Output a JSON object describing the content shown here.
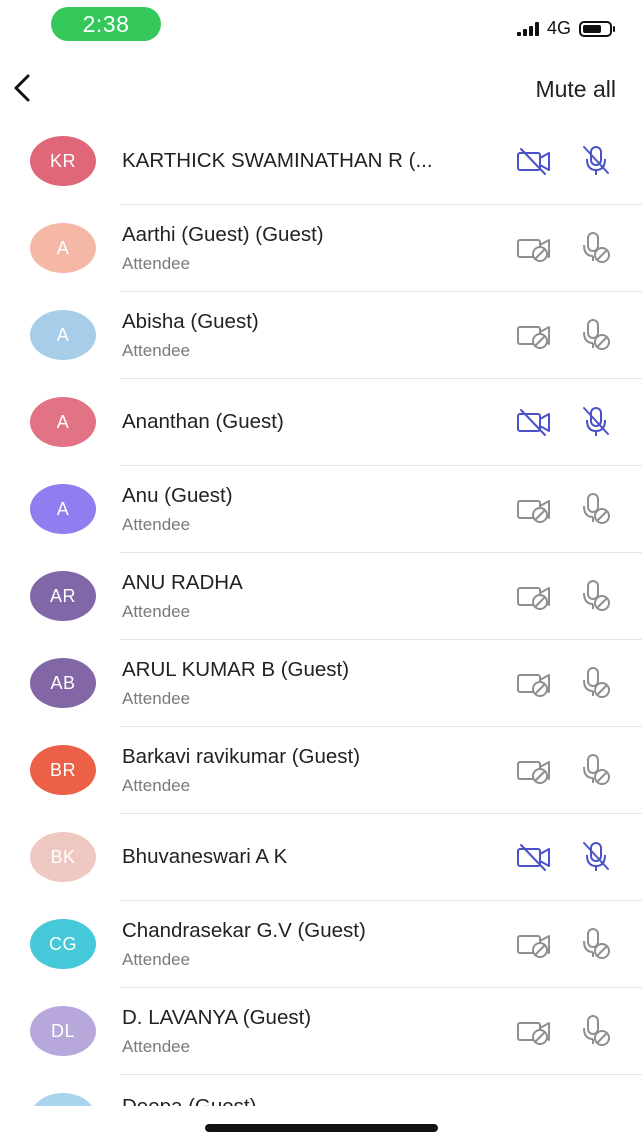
{
  "status_bar": {
    "time": "2:38",
    "network": "4G"
  },
  "header": {
    "mute_all_label": "Mute all"
  },
  "colors": {
    "active_icon": "#4b52c9",
    "inactive_icon": "#8f8f8f",
    "time_pill": "#34c759"
  },
  "participants": [
    {
      "initials": "KR",
      "name": "KARTHICK SWAMINATHAN R (...",
      "role": "",
      "avatar_color": "#e0677a",
      "video": "off-active",
      "mic": "off-active"
    },
    {
      "initials": "A",
      "name": "Aarthi (Guest) (Guest)",
      "role": "Attendee",
      "avatar_color": "#f6b8a6",
      "video": "disabled",
      "mic": "disabled"
    },
    {
      "initials": "A",
      "name": "Abisha (Guest)",
      "role": "Attendee",
      "avatar_color": "#a8cde8",
      "video": "disabled",
      "mic": "disabled"
    },
    {
      "initials": "A",
      "name": "Ananthan (Guest)",
      "role": "",
      "avatar_color": "#e27384",
      "video": "off-active",
      "mic": "off-active"
    },
    {
      "initials": "A",
      "name": "Anu (Guest)",
      "role": "Attendee",
      "avatar_color": "#8e7ef0",
      "video": "disabled",
      "mic": "disabled"
    },
    {
      "initials": "AR",
      "name": "ANU RADHA",
      "role": "Attendee",
      "avatar_color": "#8267a8",
      "video": "disabled",
      "mic": "disabled"
    },
    {
      "initials": "AB",
      "name": "ARUL KUMAR B (Guest)",
      "role": "Attendee",
      "avatar_color": "#8266a6",
      "video": "disabled",
      "mic": "disabled"
    },
    {
      "initials": "BR",
      "name": "Barkavi ravikumar (Guest)",
      "role": "Attendee",
      "avatar_color": "#ec6047",
      "video": "disabled",
      "mic": "disabled"
    },
    {
      "initials": "BK",
      "name": "Bhuvaneswari A K",
      "role": "",
      "avatar_color": "#f0c8c2",
      "video": "off-active",
      "mic": "off-active"
    },
    {
      "initials": "CG",
      "name": "Chandrasekar G.V (Guest)",
      "role": "Attendee",
      "avatar_color": "#45c8d8",
      "video": "disabled",
      "mic": "disabled"
    },
    {
      "initials": "DL",
      "name": "D. LAVANYA (Guest)",
      "role": "Attendee",
      "avatar_color": "#b8a7db",
      "video": "disabled",
      "mic": "disabled"
    }
  ],
  "partial_participant": {
    "initials": "",
    "name": "Deepa (Guest)",
    "avatar_color": "#a9d4ee"
  }
}
